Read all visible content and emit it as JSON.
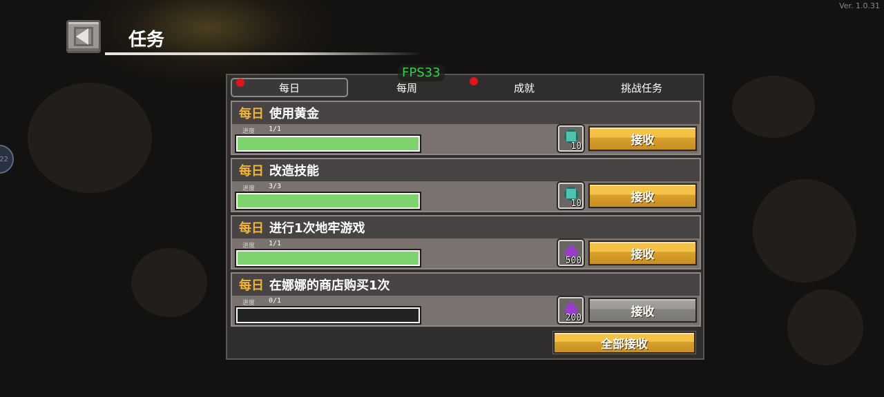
{
  "version": "Ver. 1.0.31",
  "left_badge": "22",
  "header": {
    "title": "任务"
  },
  "fps": "FPS33",
  "tabs": [
    {
      "label": "每日",
      "active": true,
      "dot": true
    },
    {
      "label": "每周",
      "active": false,
      "dot": false
    },
    {
      "label": "成就",
      "active": false,
      "dot": true
    },
    {
      "label": "挑战任务",
      "active": false,
      "dot": false
    }
  ],
  "progress_label": "进度",
  "tasks": [
    {
      "tag": "每日",
      "name": "使用黄金",
      "progress": "1/1",
      "fill": 1.0,
      "reward_icon": "teal-gem-icon",
      "reward_amount": "10",
      "button": "接收",
      "claimable": true
    },
    {
      "tag": "每日",
      "name": "改造技能",
      "progress": "3/3",
      "fill": 1.0,
      "reward_icon": "teal-gem-icon",
      "reward_amount": "10",
      "button": "接收",
      "claimable": true
    },
    {
      "tag": "每日",
      "name": "进行1次地牢游戏",
      "progress": "1/1",
      "fill": 1.0,
      "reward_icon": "purple-crystal-icon",
      "reward_amount": "500",
      "button": "接收",
      "claimable": true
    },
    {
      "tag": "每日",
      "name": "在娜娜的商店购买1次",
      "progress": "0/1",
      "fill": 0.0,
      "reward_icon": "purple-crystal-icon",
      "reward_amount": "200",
      "button": "接收",
      "claimable": false
    }
  ],
  "claim_all": "全部接收",
  "colors": {
    "tag": "#f3b53a",
    "fps": "#33d04a",
    "progress_fill": "#7ed36e",
    "tab_dot": "#e2151d"
  }
}
